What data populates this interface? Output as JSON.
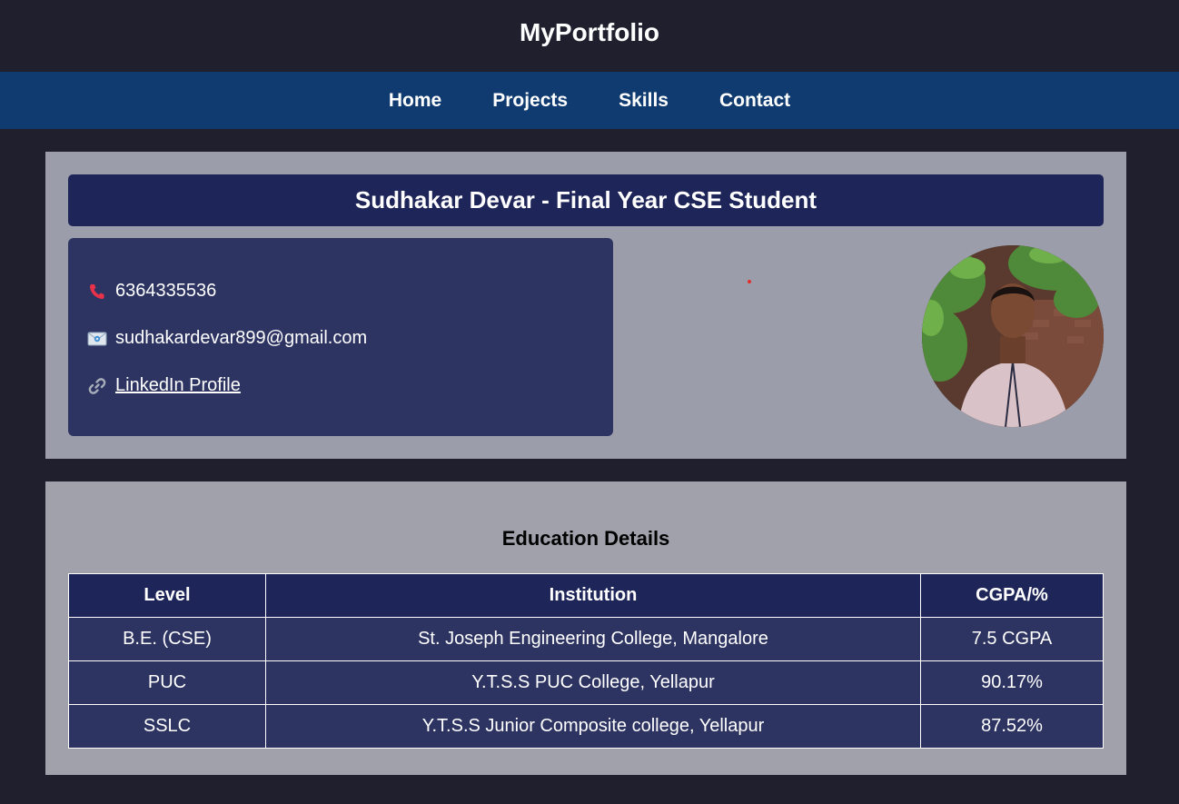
{
  "header": {
    "title": "MyPortfolio"
  },
  "nav": {
    "items": [
      {
        "label": "Home"
      },
      {
        "label": "Projects"
      },
      {
        "label": "Skills"
      },
      {
        "label": "Contact"
      }
    ]
  },
  "profile": {
    "banner": "Sudhakar Devar - Final Year CSE Student",
    "phone": "6364335536",
    "email": "sudhakardevar899@gmail.com",
    "linkedin_label": "LinkedIn Profile",
    "icons": {
      "phone": "phone-icon",
      "email": "envelope-icon",
      "link": "link-icon"
    }
  },
  "education": {
    "heading": "Education Details",
    "columns": [
      "Level",
      "Institution",
      "CGPA/%"
    ],
    "rows": [
      [
        "B.E. (CSE)",
        "St. Joseph Engineering College, Mangalore",
        "7.5 CGPA"
      ],
      [
        "PUC",
        "Y.T.S.S PUC College, Yellapur",
        "90.17%"
      ],
      [
        "SSLC",
        "Y.T.S.S Junior Composite college, Yellapur",
        "87.52%"
      ]
    ]
  },
  "colors": {
    "page_bg": "#1f1f2e",
    "nav_bg": "#0f3b70",
    "card_bg": "#9c9dab",
    "banner_bg": "#1e2558",
    "contact_bg": "#2d3462"
  }
}
